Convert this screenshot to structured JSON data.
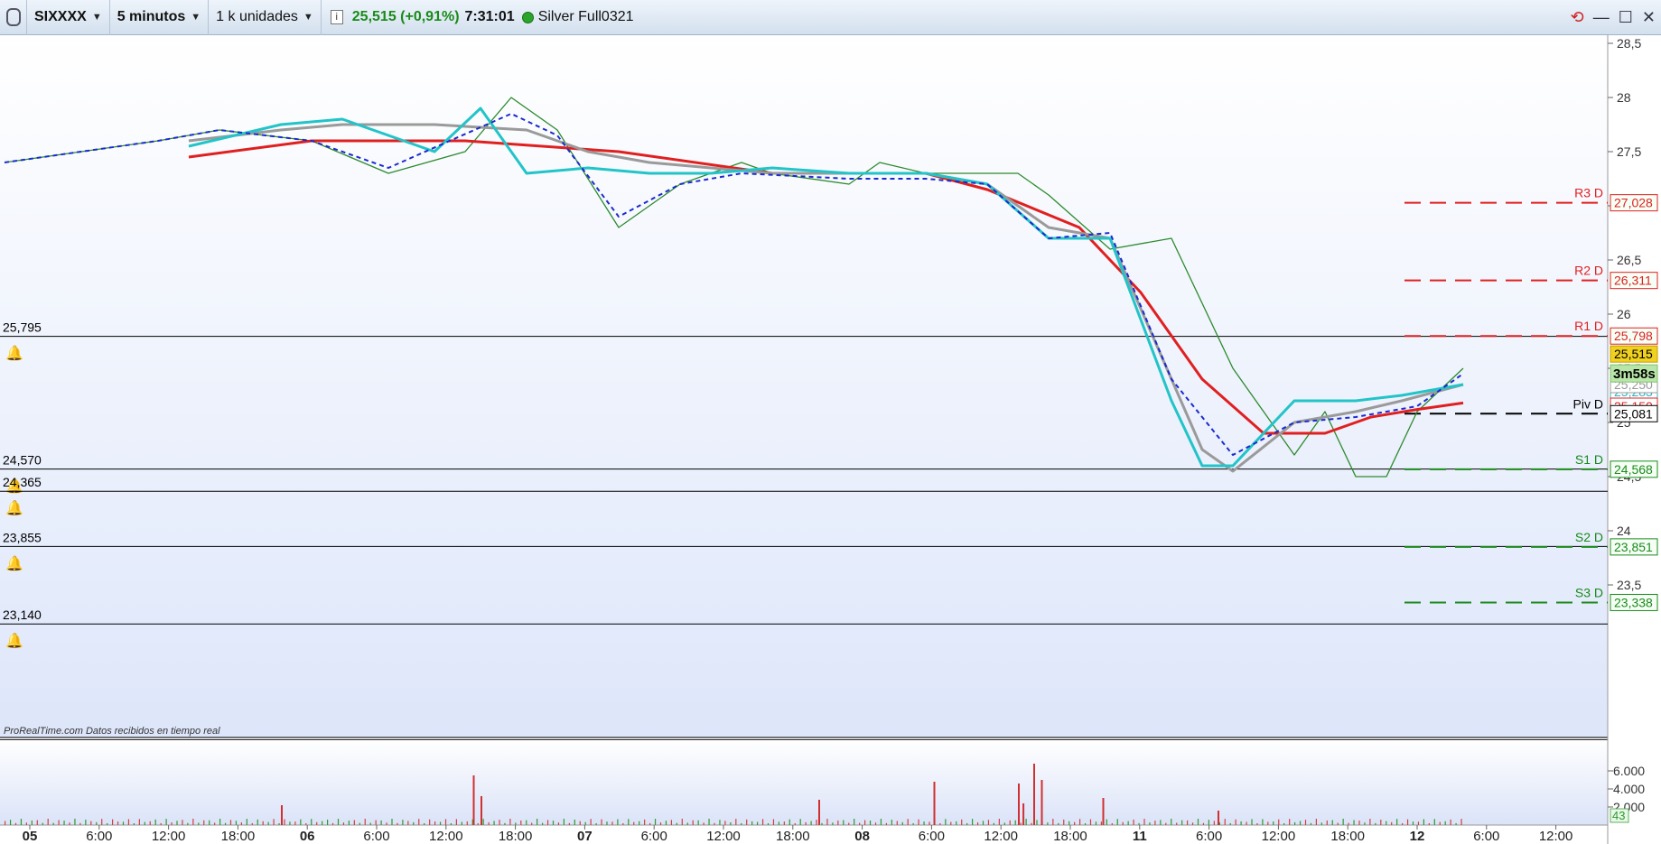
{
  "toolbar": {
    "symbol": "SIXXXX",
    "timeframe": "5 minutos",
    "units": "1 k unidades",
    "info": "i",
    "price_change": "25,515 (+0,91%)",
    "time": "7:31:01",
    "account": "Silver Full0321"
  },
  "icons": {
    "app": "prorealtime-logo-icon",
    "info": "info-icon",
    "status": "connection-status-icon",
    "sync": "sync-icon",
    "minimize": "minimize-icon",
    "maximize": "maximize-icon",
    "close": "close-icon"
  },
  "watermark": "ProRealTime.com  Datos recibidos en tiempo real",
  "chart_data": {
    "type": "line",
    "price_axis": {
      "min": 23.0,
      "max": 28.6,
      "ticks": [
        "28,5",
        "28",
        "27,5",
        "27",
        "26,5",
        "26",
        "25,5",
        "25",
        "24,5",
        "24",
        "23,5"
      ]
    },
    "volume_axis": {
      "ticks": [
        "6.000",
        "4.000",
        "2.000"
      ],
      "last_value": "43"
    },
    "x_ticks": [
      {
        "label": "05",
        "bold": true
      },
      {
        "label": "6:00"
      },
      {
        "label": "12:00"
      },
      {
        "label": "18:00"
      },
      {
        "label": "06",
        "bold": true
      },
      {
        "label": "6:00"
      },
      {
        "label": "12:00"
      },
      {
        "label": "18:00"
      },
      {
        "label": "07",
        "bold": true
      },
      {
        "label": "6:00"
      },
      {
        "label": "12:00"
      },
      {
        "label": "18:00"
      },
      {
        "label": "08",
        "bold": true
      },
      {
        "label": "6:00"
      },
      {
        "label": "12:00"
      },
      {
        "label": "18:00"
      },
      {
        "label": "11",
        "bold": true
      },
      {
        "label": "6:00"
      },
      {
        "label": "12:00"
      },
      {
        "label": "18:00"
      },
      {
        "label": "12",
        "bold": true
      },
      {
        "label": "6:00"
      },
      {
        "label": "12:00"
      }
    ],
    "alert_levels": [
      {
        "label": "25,795",
        "value": 25.795
      },
      {
        "label": "24,570",
        "value": 24.57
      },
      {
        "label": "24,365",
        "value": 24.365
      },
      {
        "label": "23,855",
        "value": 23.855
      },
      {
        "label": "23,140",
        "value": 23.14
      }
    ],
    "pivots": [
      {
        "name": "R3 D",
        "label": "27,028",
        "value": 27.028,
        "color": "#e02020"
      },
      {
        "name": "R2 D",
        "label": "26,311",
        "value": 26.311,
        "color": "#e02020"
      },
      {
        "name": "R1 D",
        "label": "25,798",
        "value": 25.798,
        "color": "#e02020"
      },
      {
        "name": "Piv D",
        "label": "25,081",
        "value": 25.081,
        "color": "#000000"
      },
      {
        "name": "S1 D",
        "label": "24,568",
        "value": 24.568,
        "color": "#1a8a1a"
      },
      {
        "name": "S2 D",
        "label": "23,851",
        "value": 23.851,
        "color": "#1a8a1a"
      },
      {
        "name": "S3 D",
        "label": "23,338",
        "value": 23.338,
        "color": "#1a8a1a"
      }
    ],
    "last_price": {
      "label": "25,515",
      "value": 25.515
    },
    "countdown": "3m58s",
    "indicator_tags": [
      {
        "label": "25,283",
        "value": 25.283,
        "color": "#22b8c8"
      },
      {
        "label": "25,150",
        "value": 25.15,
        "color": "#e02020"
      },
      {
        "label": "25,250",
        "value": 25.25,
        "color": "#999999"
      }
    ],
    "series": [
      {
        "name": "price",
        "color": "#2d8a2d",
        "x": [
          0,
          5,
          10,
          14,
          20,
          25,
          30,
          33,
          36,
          40,
          44,
          48,
          50,
          55,
          57,
          60,
          63,
          66,
          68,
          72,
          76,
          80,
          84,
          85,
          86,
          88,
          90,
          92,
          95
        ],
        "y": [
          27.4,
          27.5,
          27.6,
          27.7,
          27.6,
          27.3,
          27.5,
          28.0,
          27.7,
          26.8,
          27.2,
          27.4,
          27.3,
          27.2,
          27.4,
          27.3,
          27.3,
          27.3,
          27.1,
          26.6,
          26.7,
          25.5,
          24.7,
          24.9,
          25.1,
          24.5,
          24.5,
          25.1,
          25.5
        ]
      },
      {
        "name": "red-ma",
        "color": "#e02020",
        "x": [
          12,
          20,
          30,
          40,
          50,
          60,
          64,
          70,
          74,
          78,
          82,
          86,
          89,
          92,
          95
        ],
        "y": [
          27.45,
          27.6,
          27.6,
          27.5,
          27.3,
          27.3,
          27.15,
          26.8,
          26.2,
          25.4,
          24.9,
          24.9,
          25.05,
          25.12,
          25.18
        ]
      },
      {
        "name": "grey-ma",
        "color": "#9a9a9a",
        "x": [
          12,
          18,
          22,
          28,
          34,
          38,
          42,
          46,
          50,
          55,
          60,
          64,
          68,
          72,
          76,
          78,
          80,
          84,
          88,
          91,
          95
        ],
        "y": [
          27.6,
          27.7,
          27.75,
          27.75,
          27.7,
          27.5,
          27.4,
          27.35,
          27.3,
          27.3,
          27.3,
          27.2,
          26.8,
          26.7,
          25.4,
          24.75,
          24.55,
          25.0,
          25.1,
          25.2,
          25.35
        ]
      },
      {
        "name": "cyan-ma",
        "color": "#22c4c8",
        "x": [
          12,
          18,
          22,
          28,
          31,
          34,
          38,
          42,
          46,
          50,
          55,
          60,
          64,
          68,
          72,
          76,
          78,
          80,
          84,
          88,
          91,
          95
        ],
        "y": [
          27.55,
          27.75,
          27.8,
          27.5,
          27.9,
          27.3,
          27.35,
          27.3,
          27.3,
          27.35,
          27.3,
          27.3,
          27.2,
          26.7,
          26.7,
          25.2,
          24.6,
          24.6,
          25.2,
          25.2,
          25.25,
          25.35
        ]
      },
      {
        "name": "blue-dash",
        "color": "#1a2ad0",
        "x": [
          0,
          5,
          10,
          14,
          20,
          25,
          29,
          33,
          36,
          40,
          44,
          48,
          55,
          60,
          64,
          68,
          72,
          76,
          80,
          84,
          88,
          92,
          95
        ],
        "y": [
          27.4,
          27.5,
          27.6,
          27.7,
          27.6,
          27.35,
          27.6,
          27.85,
          27.65,
          26.9,
          27.2,
          27.3,
          27.25,
          27.25,
          27.2,
          26.7,
          26.75,
          25.4,
          24.7,
          25.0,
          25.05,
          25.15,
          25.45
        ]
      }
    ],
    "volume": {
      "spikes": [
        {
          "x": 30.5,
          "v": 5500
        },
        {
          "x": 31,
          "v": 3200
        },
        {
          "x": 53,
          "v": 2800
        },
        {
          "x": 60.5,
          "v": 4800
        },
        {
          "x": 66,
          "v": 4600
        },
        {
          "x": 66.3,
          "v": 2400
        },
        {
          "x": 67,
          "v": 6800
        },
        {
          "x": 67.5,
          "v": 5000
        },
        {
          "x": 71.5,
          "v": 3000
        },
        {
          "x": 79,
          "v": 1600
        },
        {
          "x": 18,
          "v": 2200
        }
      ]
    }
  }
}
